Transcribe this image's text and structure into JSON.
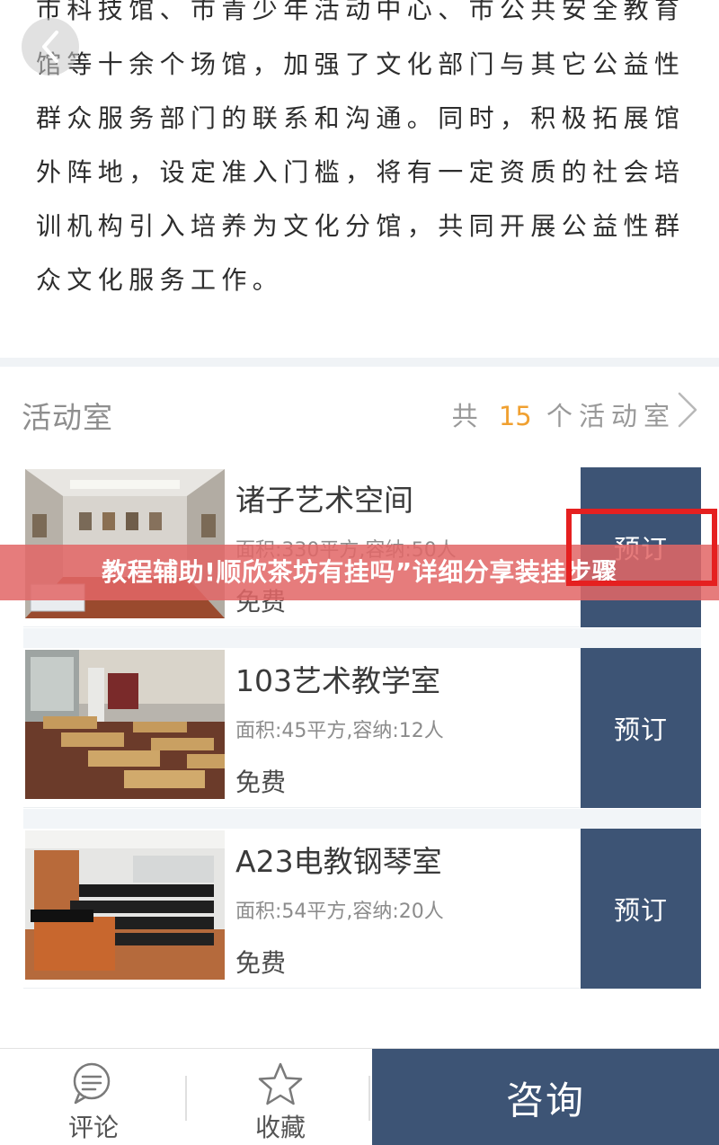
{
  "intro": {
    "lines": [
      "市科技馆、市青少年活动中心、市公共安全教育",
      "馆等十余个场馆，加强了文化部门与其它公益性",
      "群众服务部门的联系和沟通。同时，积极拓展馆",
      "外阵地，设定准入门槛，将有一定资质的社会培",
      "训机构引入培养为文化分馆，共同开展公益性群",
      "众文化服务工作。"
    ]
  },
  "nav": {
    "back_icon": "chevron-left-icon"
  },
  "section": {
    "title": "活动室",
    "count_prefix": "共",
    "count": "15",
    "count_suffix": "个活动室",
    "more_icon": "chevron-right-icon"
  },
  "rooms": [
    {
      "name": "诸子艺术空间",
      "info": "面积:330平方,容纳:50人",
      "price": "免费",
      "book_label": "预订"
    },
    {
      "name": "103艺术教学室",
      "info": "面积:45平方,容纳:12人",
      "price": "免费",
      "book_label": "预订"
    },
    {
      "name": "A23电教钢琴室",
      "info": "面积:54平方,容纳:20人",
      "price": "免费",
      "book_label": "预订"
    }
  ],
  "banner": {
    "text": "教程辅助!顺欣茶坊有挂吗”详细分享装挂步骤"
  },
  "bottom_bar": {
    "comment_label": "评论",
    "comment_icon": "comment-bubble-icon",
    "favorite_label": "收藏",
    "favorite_icon": "star-outline-icon",
    "consult_label": "咨询"
  },
  "colors": {
    "accent_navy": "#3d5475",
    "count_orange": "#f0a030",
    "banner_red": "#e26666",
    "highlight_red": "#e52020"
  }
}
